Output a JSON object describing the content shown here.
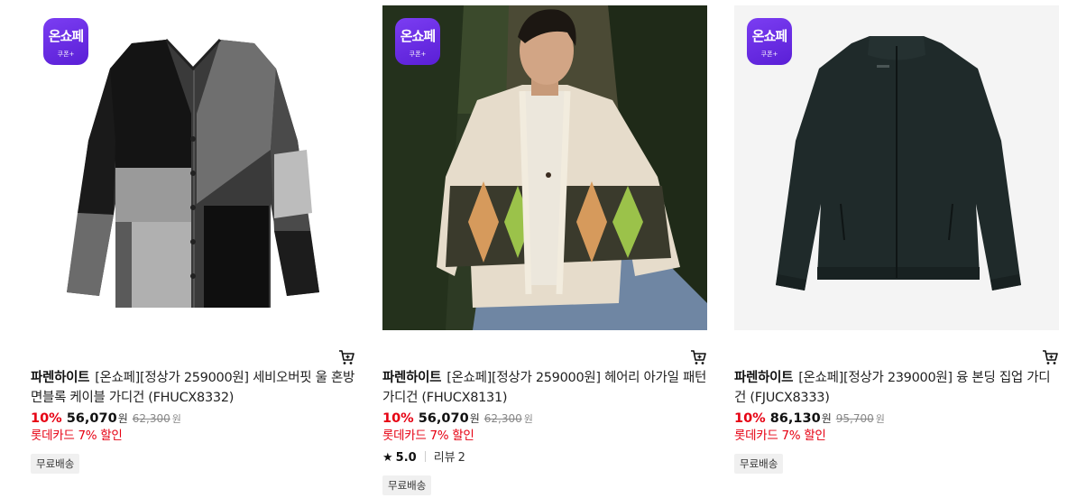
{
  "badge": {
    "main": "온쇼페",
    "sub": "쿠폰+"
  },
  "products": [
    {
      "brand": "파렌하이트",
      "name": "[온쇼페][정상가 259000원] 세비오버핏 울 혼방 면블록 케이블 가디건 (FHUCX8332)",
      "discount_rate": "10%",
      "sale_price": "56,070",
      "won": "원",
      "original_price": "62,300",
      "card_discount": "롯데카드 7% 할인",
      "shipping": "무료배송"
    },
    {
      "brand": "파렌하이트",
      "name": "[온쇼페][정상가 259000원] 헤어리 아가일 패턴 가디건 (FHUCX8131)",
      "discount_rate": "10%",
      "sale_price": "56,070",
      "won": "원",
      "original_price": "62,300",
      "card_discount": "롯데카드 7% 할인",
      "rating": "5.0",
      "review_label": "리뷰",
      "review_count": "2",
      "shipping": "무료배송"
    },
    {
      "brand": "파렌하이트",
      "name": "[온쇼페][정상가 239000원] 융 본딩 집업 가디건 (FJUCX8333)",
      "discount_rate": "10%",
      "sale_price": "86,130",
      "won": "원",
      "original_price": "95,700",
      "card_discount": "롯데카드 7% 할인",
      "shipping": "무료배송"
    }
  ],
  "icons": {
    "cart": "cart-icon",
    "star": "star-icon"
  },
  "colors": {
    "accent_red": "#e60012",
    "badge_purple": "#6a2ee8"
  }
}
